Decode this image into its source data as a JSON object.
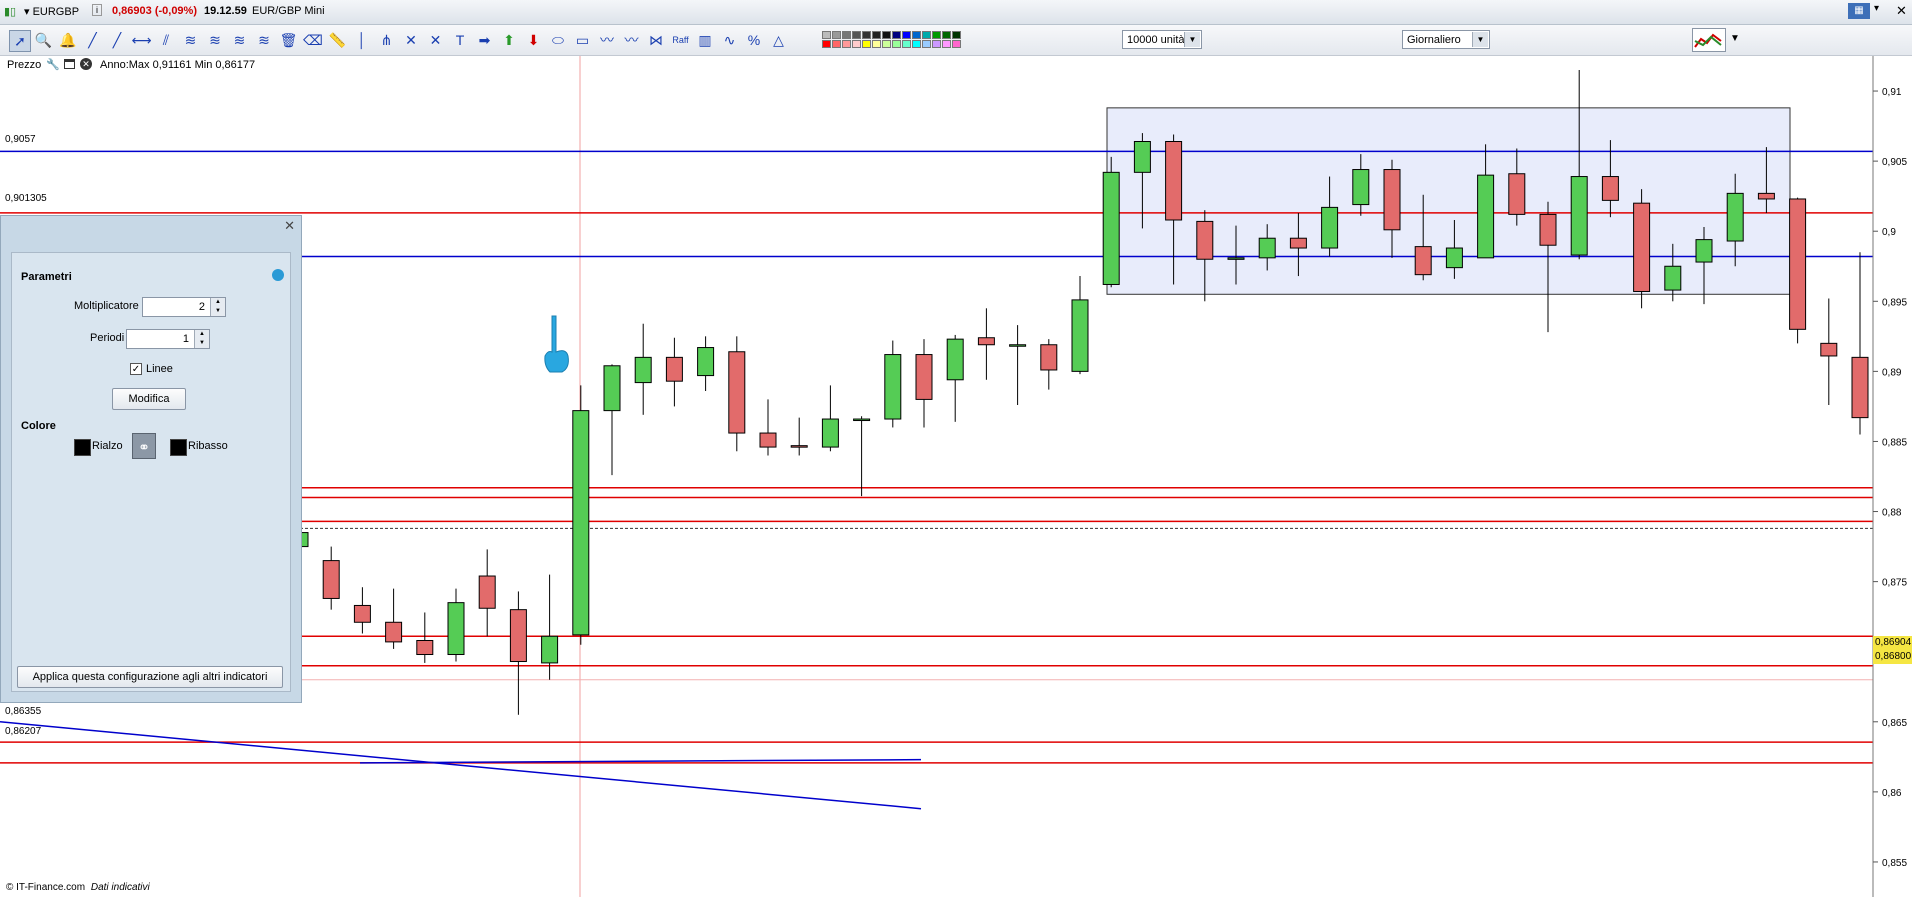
{
  "titlebar": {
    "symbol": "EURGBP",
    "change": "0,86903 (-0,09%)",
    "time": "19.12.59",
    "instrument": "EUR/GBP Mini",
    "info_icon": "i"
  },
  "toolbar": {
    "quantity": "10000 unità",
    "timeframe": "Giornaliero",
    "raff_label": "Raff",
    "percent_label": "%",
    "text_tool": "T",
    "icons": [
      "pointer-icon",
      "zoom-icon",
      "alarm-bell-icon",
      "line-icon",
      "line-icon",
      "horizontal-line-icon",
      "channel-icon",
      "fibonacci-icon",
      "fibonacci-icon",
      "fibonacci-icon",
      "fibonacci-icon",
      "trash-icon",
      "eraser-icon",
      "ruler-icon",
      "vertical-line-icon",
      "pitchfork-icon",
      "cross-icon",
      "cross-icon",
      "text-icon",
      "arrow-right-icon",
      "arrow-up-icon",
      "arrow-down-icon",
      "ellipse-icon",
      "rectangle-icon",
      "wave-icon",
      "wave-icon",
      "gann-icon",
      "raff-icon",
      "grid-icon",
      "cycle-icon",
      "percent-icon",
      "triangle-icon"
    ]
  },
  "legend": {
    "prezzo": "Prezzo",
    "anno": "Anno:Max 0,91161 Min 0,86177"
  },
  "price_labels": {
    "l1": "0,9057",
    "l2": "0,901305",
    "l3": "0,86355",
    "l4": "0,86207"
  },
  "axis_badges": {
    "current": "0,86904",
    "other": "0,86800"
  },
  "footer": {
    "copyright": "© IT-Finance.com",
    "note": "Dati indicativi"
  },
  "panel": {
    "parametri": "Parametri",
    "moltiplicatore_label": "Moltiplicatore",
    "moltiplicatore_value": "2",
    "periodi_label": "Periodi",
    "periodi_value": "1",
    "linee_label": "Linee",
    "modifica": "Modifica",
    "colore": "Colore",
    "rialzo": "Rialzo",
    "ribasso": "Ribasso",
    "apply": "Applica questa configurazione agli altri indicatori"
  },
  "colors": {
    "up": "#55cc55",
    "down": "#e26b6b",
    "red_line": "#e00000",
    "blue_line": "#0000cc",
    "box_fill": "#e8ecfb"
  },
  "chart_data": {
    "type": "candlestick",
    "y_ticks": [
      "0,91",
      "0,905",
      "0,9",
      "0,895",
      "0,89",
      "0,885",
      "0,88",
      "0,875",
      "0,87",
      "0,865",
      "0,86",
      "0,855"
    ],
    "ylim": [
      0.8525,
      0.9125
    ],
    "candles": [
      {
        "o": 0.8775,
        "h": 0.878,
        "l": 0.876,
        "c": 0.8785
      },
      {
        "o": 0.8765,
        "h": 0.8775,
        "l": 0.873,
        "c": 0.8738
      },
      {
        "o": 0.8733,
        "h": 0.8746,
        "l": 0.8713,
        "c": 0.8721
      },
      {
        "o": 0.8721,
        "h": 0.8745,
        "l": 0.8702,
        "c": 0.8707
      },
      {
        "o": 0.8708,
        "h": 0.8728,
        "l": 0.8692,
        "c": 0.8698
      },
      {
        "o": 0.8698,
        "h": 0.8745,
        "l": 0.8693,
        "c": 0.8735
      },
      {
        "o": 0.8754,
        "h": 0.8773,
        "l": 0.8711,
        "c": 0.8731
      },
      {
        "o": 0.873,
        "h": 0.8743,
        "l": 0.8655,
        "c": 0.8693
      },
      {
        "o": 0.8692,
        "h": 0.8755,
        "l": 0.868,
        "c": 0.8711
      },
      {
        "o": 0.8712,
        "h": 0.889,
        "l": 0.8705,
        "c": 0.8872
      },
      {
        "o": 0.8872,
        "h": 0.8905,
        "l": 0.8826,
        "c": 0.8904
      },
      {
        "o": 0.8892,
        "h": 0.8934,
        "l": 0.8869,
        "c": 0.891
      },
      {
        "o": 0.891,
        "h": 0.8924,
        "l": 0.8875,
        "c": 0.8893
      },
      {
        "o": 0.8897,
        "h": 0.8925,
        "l": 0.8886,
        "c": 0.8917
      },
      {
        "o": 0.8914,
        "h": 0.8925,
        "l": 0.8843,
        "c": 0.8856
      },
      {
        "o": 0.8856,
        "h": 0.888,
        "l": 0.884,
        "c": 0.8846
      },
      {
        "o": 0.8847,
        "h": 0.8867,
        "l": 0.884,
        "c": 0.8846
      },
      {
        "o": 0.8846,
        "h": 0.889,
        "l": 0.8843,
        "c": 0.8866
      },
      {
        "o": 0.8866,
        "h": 0.8868,
        "l": 0.8811,
        "c": 0.8866
      },
      {
        "o": 0.8866,
        "h": 0.8922,
        "l": 0.886,
        "c": 0.8912
      },
      {
        "o": 0.8912,
        "h": 0.8923,
        "l": 0.886,
        "c": 0.888
      },
      {
        "o": 0.8894,
        "h": 0.8926,
        "l": 0.8864,
        "c": 0.8923
      },
      {
        "o": 0.8924,
        "h": 0.8945,
        "l": 0.8894,
        "c": 0.8919
      },
      {
        "o": 0.8919,
        "h": 0.8933,
        "l": 0.8876,
        "c": 0.8919
      },
      {
        "o": 0.8919,
        "h": 0.8923,
        "l": 0.8887,
        "c": 0.8901
      },
      {
        "o": 0.89,
        "h": 0.8968,
        "l": 0.8898,
        "c": 0.8951
      },
      {
        "o": 0.8962,
        "h": 0.9053,
        "l": 0.896,
        "c": 0.9042
      },
      {
        "o": 0.9042,
        "h": 0.907,
        "l": 0.9002,
        "c": 0.9064
      },
      {
        "o": 0.9064,
        "h": 0.9069,
        "l": 0.8962,
        "c": 0.9008
      },
      {
        "o": 0.9007,
        "h": 0.9015,
        "l": 0.895,
        "c": 0.898
      },
      {
        "o": 0.898,
        "h": 0.9004,
        "l": 0.8962,
        "c": 0.8981
      },
      {
        "o": 0.8981,
        "h": 0.9005,
        "l": 0.8972,
        "c": 0.8995
      },
      {
        "o": 0.8995,
        "h": 0.9013,
        "l": 0.8968,
        "c": 0.8988
      },
      {
        "o": 0.8988,
        "h": 0.9039,
        "l": 0.8982,
        "c": 0.9017
      },
      {
        "o": 0.9019,
        "h": 0.9055,
        "l": 0.9011,
        "c": 0.9044
      },
      {
        "o": 0.9044,
        "h": 0.9051,
        "l": 0.8981,
        "c": 0.9001
      },
      {
        "o": 0.8989,
        "h": 0.9026,
        "l": 0.8965,
        "c": 0.8969
      },
      {
        "o": 0.8974,
        "h": 0.9008,
        "l": 0.8966,
        "c": 0.8988
      },
      {
        "o": 0.8981,
        "h": 0.9062,
        "l": 0.8981,
        "c": 0.904
      },
      {
        "o": 0.9041,
        "h": 0.9059,
        "l": 0.9004,
        "c": 0.9012
      },
      {
        "o": 0.9012,
        "h": 0.9021,
        "l": 0.8928,
        "c": 0.899
      },
      {
        "o": 0.8983,
        "h": 0.9115,
        "l": 0.898,
        "c": 0.9039
      },
      {
        "o": 0.9039,
        "h": 0.9065,
        "l": 0.901,
        "c": 0.9022
      },
      {
        "o": 0.902,
        "h": 0.903,
        "l": 0.8945,
        "c": 0.8957
      },
      {
        "o": 0.8958,
        "h": 0.8991,
        "l": 0.895,
        "c": 0.8975
      },
      {
        "o": 0.8978,
        "h": 0.9003,
        "l": 0.8948,
        "c": 0.8994
      },
      {
        "o": 0.8993,
        "h": 0.9041,
        "l": 0.8975,
        "c": 0.9027
      },
      {
        "o": 0.9027,
        "h": 0.906,
        "l": 0.9013,
        "c": 0.9023
      },
      {
        "o": 0.9023,
        "h": 0.9024,
        "l": 0.892,
        "c": 0.893
      },
      {
        "o": 0.892,
        "h": 0.8952,
        "l": 0.8876,
        "c": 0.8911
      },
      {
        "o": 0.891,
        "h": 0.8985,
        "l": 0.8855,
        "c": 0.8867
      }
    ],
    "horizontal_lines": [
      {
        "price": 0.9057,
        "color": "blue"
      },
      {
        "price": 0.901305,
        "color": "red"
      },
      {
        "price": 0.8982,
        "color": "blue"
      },
      {
        "price": 0.8817,
        "color": "red"
      },
      {
        "price": 0.881,
        "color": "red"
      },
      {
        "price": 0.8793,
        "color": "red"
      },
      {
        "price": 0.8711,
        "color": "red"
      },
      {
        "price": 0.869,
        "color": "red"
      },
      {
        "price": 0.86355,
        "color": "red"
      },
      {
        "price": 0.86207,
        "color": "red"
      }
    ],
    "dashed_line_price": 0.8788,
    "current_price_line": 0.868
  }
}
